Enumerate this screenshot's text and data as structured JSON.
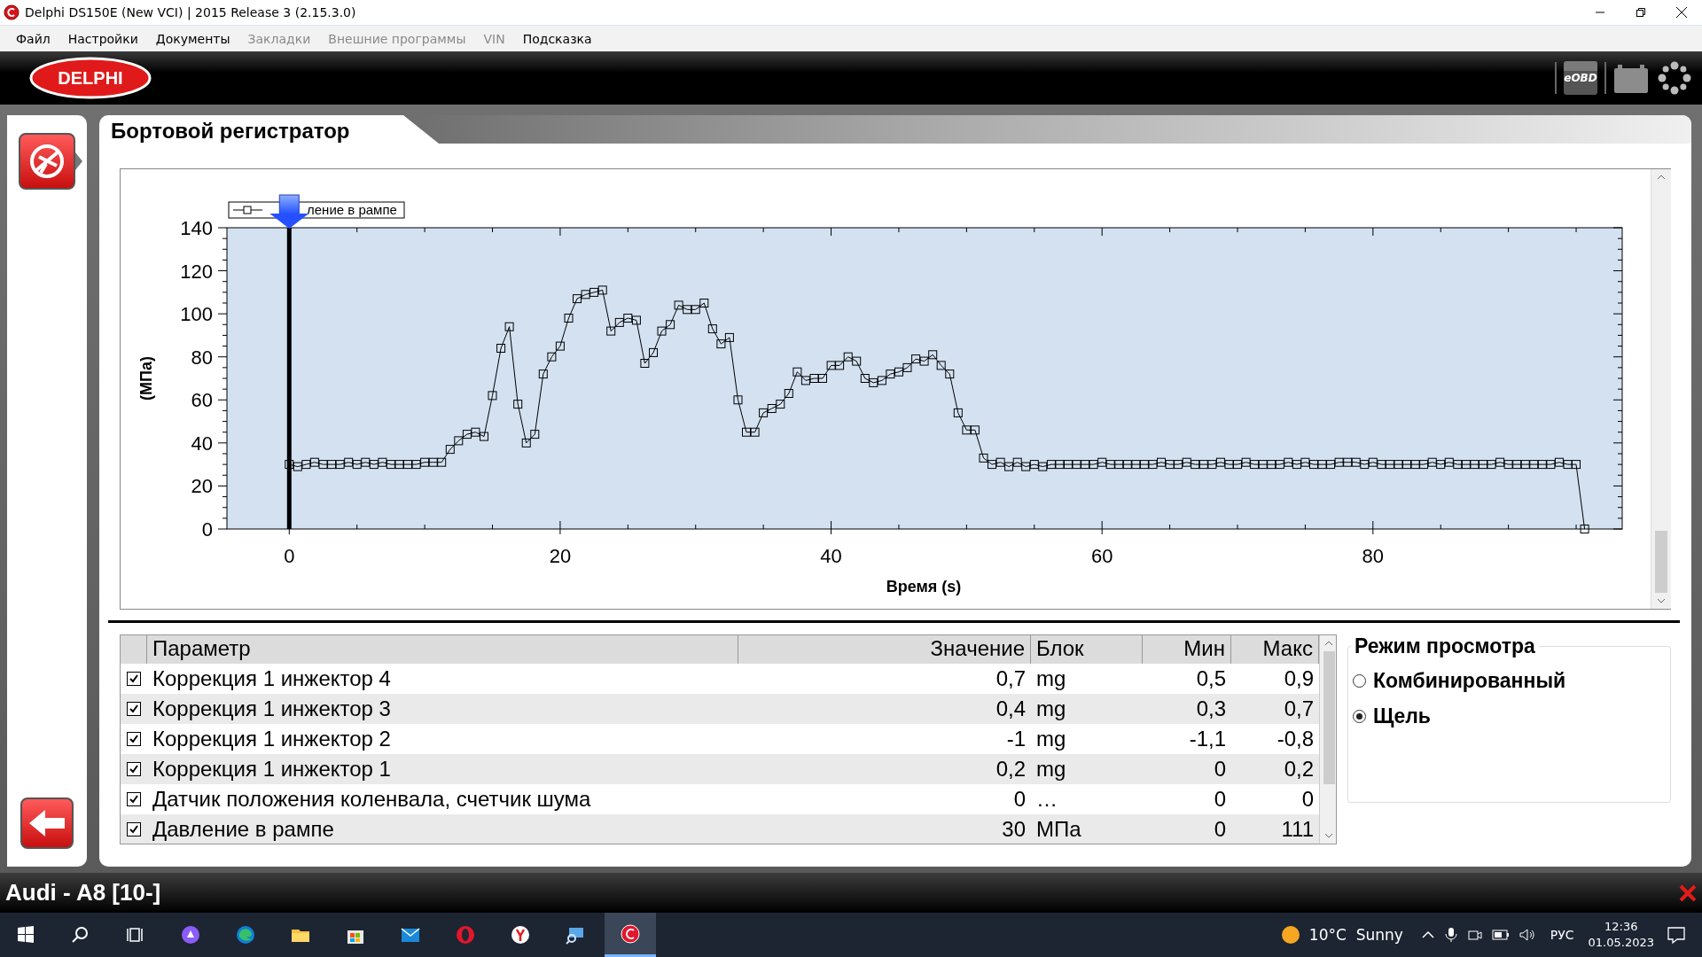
{
  "window": {
    "title": "Delphi DS150E (New VCI) | 2015 Release 3 (2.15.3.0)"
  },
  "menu": [
    {
      "label": "Файл",
      "disabled": false
    },
    {
      "label": "Настройки",
      "disabled": false
    },
    {
      "label": "Документы",
      "disabled": false
    },
    {
      "label": "Закладки",
      "disabled": true
    },
    {
      "label": "Внешние программы",
      "disabled": true
    },
    {
      "label": "VIN",
      "disabled": true
    },
    {
      "label": "Подсказка",
      "disabled": false
    }
  ],
  "header": {
    "logo": "DELPHI",
    "obd_label": "eOBD"
  },
  "page": {
    "title": "Бортовой регистратор"
  },
  "chart": {
    "chart_data": {
      "type": "line",
      "xlabel": "Время (s)",
      "ylabel": "(МПа)",
      "xlim": [
        -4.6,
        98.4
      ],
      "ylim": [
        0,
        140
      ],
      "xticks": [
        0,
        20,
        40,
        60,
        80
      ],
      "yticks": [
        0,
        20,
        40,
        60,
        80,
        100,
        120,
        140
      ],
      "ref_lines": [
        {
          "axis": "x",
          "value": 0
        }
      ],
      "x": [
        0,
        0.625,
        1.25,
        1.875,
        2.5,
        3.125,
        3.75,
        4.375,
        5,
        5.625,
        6.25,
        6.875,
        7.5,
        8.125,
        8.75,
        9.375,
        10,
        10.625,
        11.25,
        11.875,
        12.5,
        13.125,
        13.75,
        14.375,
        15,
        15.625,
        16.25,
        16.875,
        17.5,
        18.125,
        18.75,
        19.375,
        20,
        20.625,
        21.25,
        21.875,
        22.5,
        23.125,
        23.75,
        24.375,
        25,
        25.625,
        26.25,
        26.875,
        27.5,
        28.125,
        28.75,
        29.375,
        30,
        30.625,
        31.25,
        31.875,
        32.5,
        33.125,
        33.75,
        34.375,
        35,
        35.625,
        36.25,
        36.875,
        37.5,
        38.125,
        38.75,
        39.375,
        40,
        40.625,
        41.25,
        41.875,
        42.5,
        43.125,
        43.75,
        44.375,
        45,
        45.625,
        46.25,
        46.875,
        47.5,
        48.125,
        48.75,
        49.375,
        50,
        50.625,
        51.25,
        51.875,
        52.5,
        53.125,
        53.75,
        54.375,
        55,
        55.625,
        56.25,
        56.875,
        57.5,
        58.125,
        58.75,
        59.375,
        60,
        60.625,
        61.25,
        61.875,
        62.5,
        63.125,
        63.75,
        64.375,
        65,
        65.625,
        66.25,
        66.875,
        67.5,
        68.125,
        68.75,
        69.375,
        70,
        70.625,
        71.25,
        71.875,
        72.5,
        73.125,
        73.75,
        74.375,
        75,
        75.625,
        76.25,
        76.875,
        77.5,
        78.125,
        78.75,
        79.375,
        80,
        80.625,
        81.25,
        81.875,
        82.5,
        83.125,
        83.75,
        84.375,
        85,
        85.625,
        86.25,
        86.875,
        87.5,
        88.125,
        88.75,
        89.375,
        90,
        90.625,
        91.25,
        91.875,
        92.5,
        93.125,
        93.75,
        94.375,
        95,
        95.625
      ],
      "series": [
        {
          "name": "ление в рампе",
          "color": "#000000",
          "marker": "square",
          "values": [
            30,
            29,
            30,
            31,
            30,
            30,
            30,
            31,
            30,
            31,
            30,
            31,
            30,
            30,
            30,
            30,
            31,
            31,
            31,
            37,
            41,
            44,
            45,
            43,
            62,
            84,
            94,
            58,
            40,
            44,
            72,
            80,
            85,
            98,
            107,
            109,
            110,
            111,
            92,
            96,
            98,
            97,
            77,
            82,
            92,
            95,
            104,
            102,
            102,
            105,
            93,
            86,
            89,
            60,
            45,
            45,
            54,
            56,
            58,
            63,
            73,
            69,
            70,
            70,
            76,
            76,
            80,
            78,
            70,
            68,
            69,
            72,
            73,
            75,
            79,
            78,
            81,
            76,
            72,
            54,
            46,
            46,
            33,
            30,
            31,
            29,
            31,
            29,
            30,
            29,
            30,
            30,
            30,
            30,
            30,
            30,
            31,
            30,
            30,
            30,
            30,
            30,
            30,
            31,
            30,
            30,
            31,
            30,
            30,
            30,
            31,
            30,
            30,
            31,
            30,
            30,
            30,
            30,
            31,
            30,
            31,
            30,
            30,
            30,
            31,
            31,
            31,
            30,
            31,
            30,
            30,
            30,
            30,
            30,
            30,
            31,
            30,
            31,
            30,
            30,
            30,
            30,
            30,
            31,
            30,
            30,
            30,
            30,
            30,
            30,
            31,
            30,
            30,
            0
          ]
        }
      ]
    }
  },
  "table": {
    "columns": [
      "Параметр",
      "Значение",
      "Блок",
      "Мин",
      "Макс"
    ],
    "rows": [
      {
        "checked": true,
        "cells": [
          "Коррекция 1 инжектор 4",
          "0,7",
          "mg",
          "0,5",
          "0,9"
        ]
      },
      {
        "checked": true,
        "cells": [
          "Коррекция 1 инжектор 3",
          "0,4",
          "mg",
          "0,3",
          "0,7"
        ]
      },
      {
        "checked": true,
        "cells": [
          "Коррекция 1 инжектор 2",
          "-1",
          "mg",
          "-1,1",
          "-0,8"
        ]
      },
      {
        "checked": true,
        "cells": [
          "Коррекция 1 инжектор 1",
          "0,2",
          "mg",
          "0",
          "0,2"
        ]
      },
      {
        "checked": true,
        "cells": [
          "Датчик положения коленвала, счетчик шума",
          "0",
          "…",
          "0",
          "0"
        ]
      },
      {
        "checked": true,
        "cells": [
          "Давление в рампе",
          "30",
          "МПа",
          "0",
          "111"
        ]
      }
    ]
  },
  "view_mode": {
    "title": "Режим просмотра",
    "options": [
      {
        "label": "Комбинированный",
        "selected": false
      },
      {
        "label": "Щель",
        "selected": true
      }
    ]
  },
  "status_bar": {
    "vehicle": "Audi - A8 [10-]"
  },
  "taskbar": {
    "apps": [
      {
        "kind": "start",
        "selected": false
      },
      {
        "kind": "search",
        "selected": false
      },
      {
        "kind": "taskview",
        "selected": false
      },
      {
        "kind": "assistant",
        "selected": false
      },
      {
        "kind": "edge",
        "selected": false
      },
      {
        "kind": "explorer",
        "selected": false
      },
      {
        "kind": "store",
        "selected": false
      },
      {
        "kind": "mail",
        "selected": false
      },
      {
        "kind": "opera",
        "selected": false
      },
      {
        "kind": "yandex",
        "selected": false
      },
      {
        "kind": "remote",
        "selected": false
      },
      {
        "kind": "delphi",
        "selected": true
      }
    ],
    "weather": "10°C  Sunny",
    "language": "РУС",
    "time": "12:36",
    "date": "01.05.2023"
  }
}
